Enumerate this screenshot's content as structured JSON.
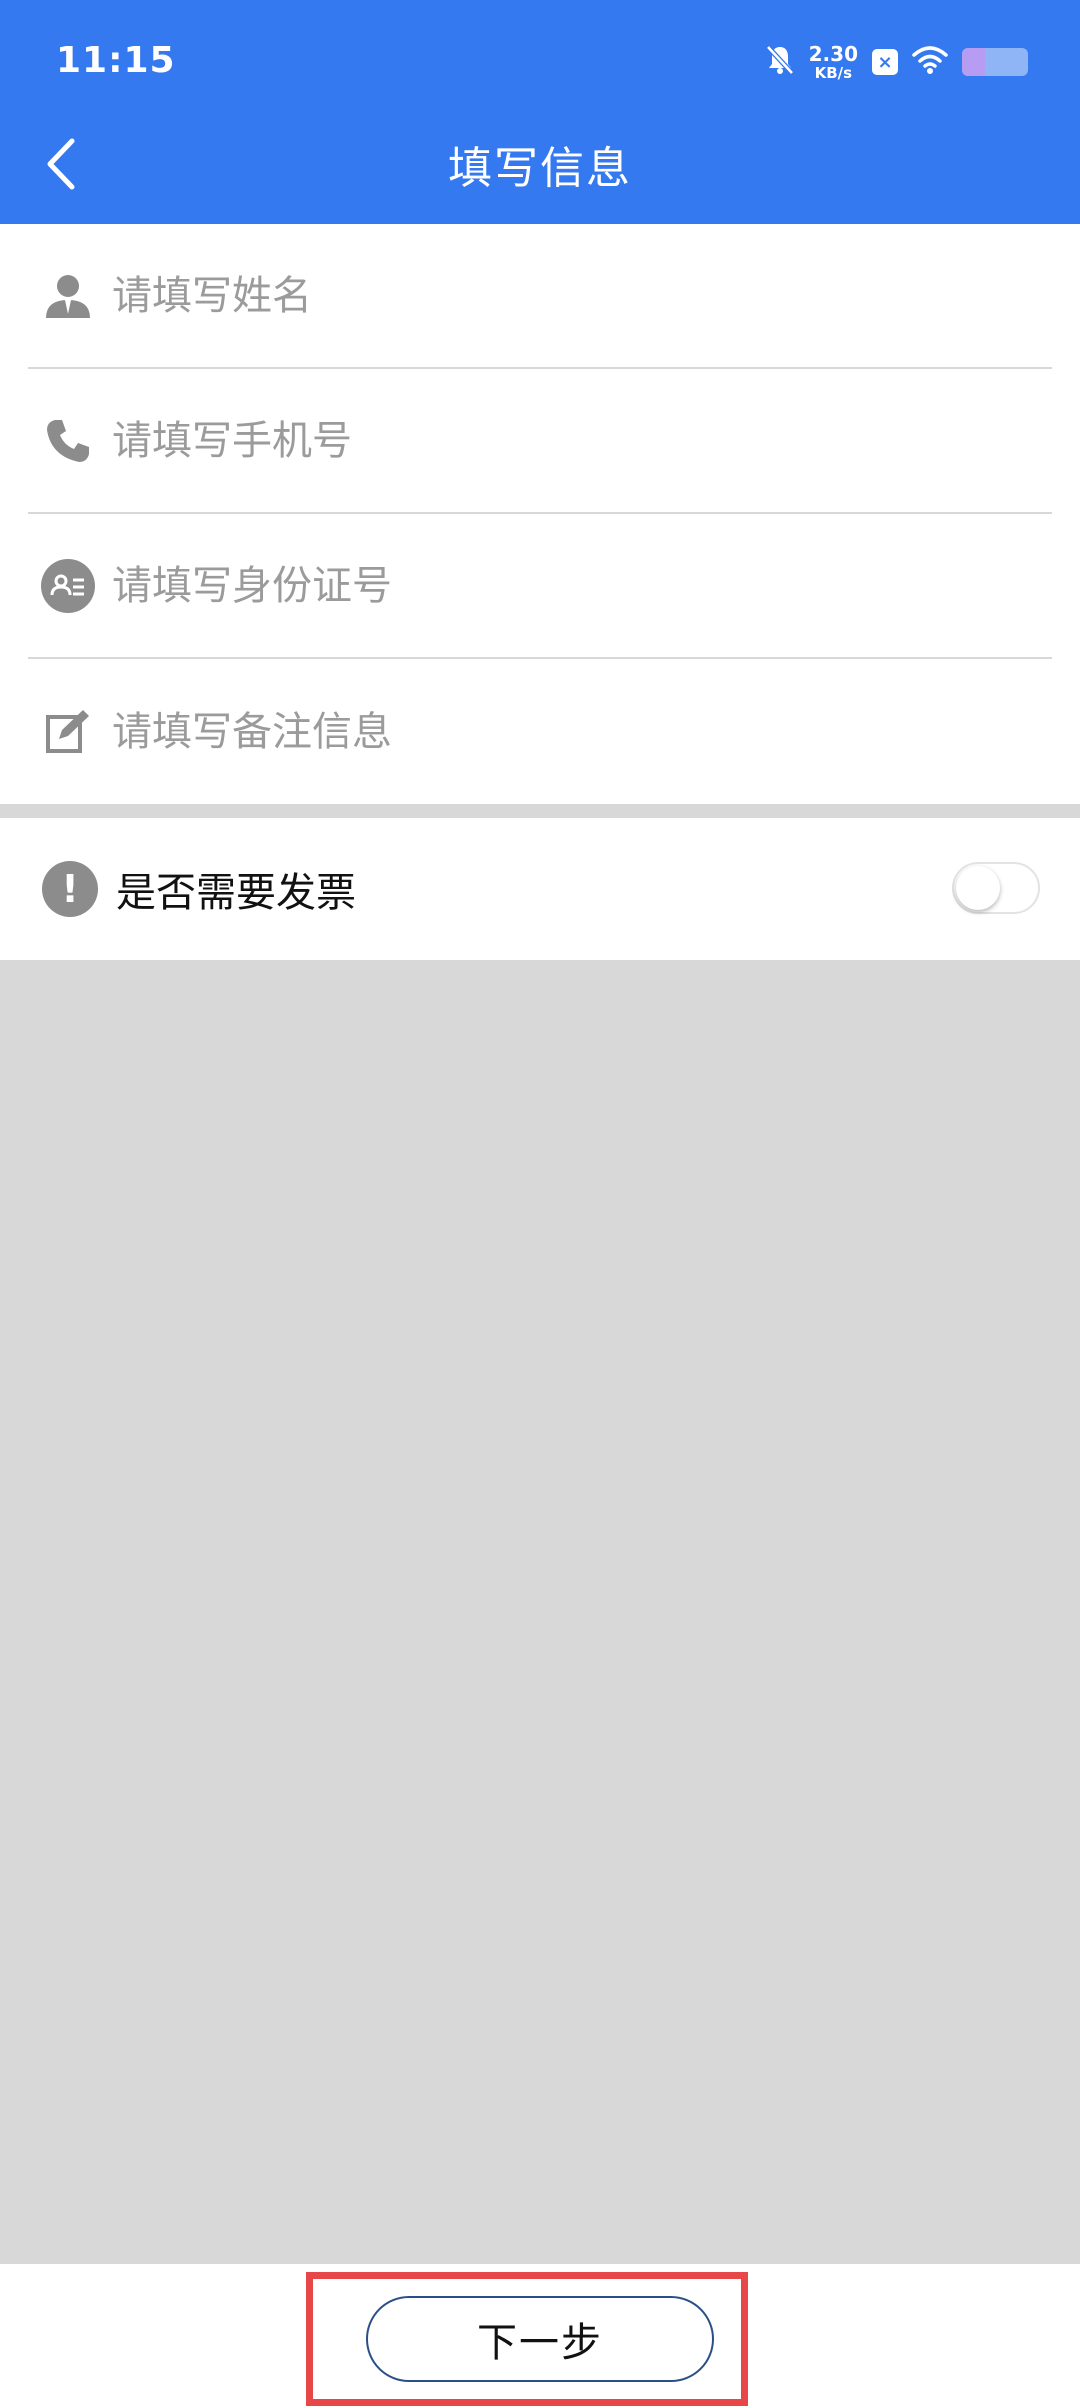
{
  "status_bar": {
    "time": "11:15",
    "net_speed_value": "2.30",
    "net_speed_unit": "KB/s",
    "battery_level": 0.35,
    "icons": [
      "mute-bell-icon",
      "app-notification-icon",
      "wifi-icon",
      "battery-icon"
    ]
  },
  "nav": {
    "title": "填写信息",
    "back_icon": "chevron-left-icon"
  },
  "form": {
    "fields": [
      {
        "placeholder": "请填写姓名",
        "value": "",
        "icon": "person-icon"
      },
      {
        "placeholder": "请填写手机号",
        "value": "",
        "icon": "phone-icon"
      },
      {
        "placeholder": "请填写身份证号",
        "value": "",
        "icon": "id-card-icon"
      },
      {
        "placeholder": "请填写备注信息",
        "value": "",
        "icon": "edit-note-icon"
      }
    ]
  },
  "invoice": {
    "label": "是否需要发票",
    "icon": "exclamation-icon",
    "enabled": false
  },
  "footer": {
    "next_label": "下一步"
  },
  "colors": {
    "header_bg": "#3579f0",
    "page_bg": "#d8d8d8",
    "highlight": "#e8474a",
    "button_border": "#2a4f88"
  }
}
